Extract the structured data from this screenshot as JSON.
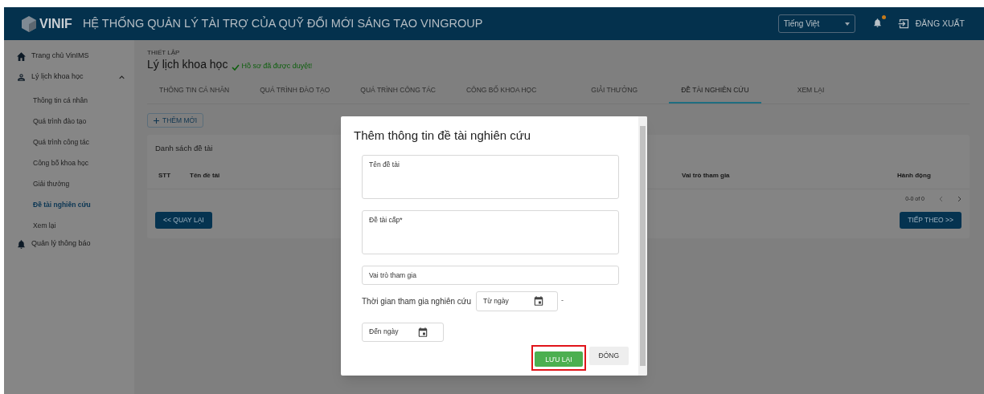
{
  "header": {
    "brand": "VINIF",
    "title": "HỆ THỐNG QUẢN LÝ TÀI TRỢ CỦA QUỸ ĐỔI MỚI SÁNG TẠO VINGROUP",
    "language": "Tiếng Việt",
    "notification_unread": true,
    "logout": "ĐĂNG XUẤT"
  },
  "sidebar": {
    "items": [
      {
        "label": "Trang chủ VinIMS"
      },
      {
        "label": "Lý lịch khoa học",
        "expanded": true,
        "children": [
          {
            "label": "Thông tin cá nhân",
            "selected": false
          },
          {
            "label": "Quá trình đào tạo",
            "selected": false
          },
          {
            "label": "Quá trình công tác",
            "selected": false
          },
          {
            "label": "Công bố khoa học",
            "selected": false
          },
          {
            "label": "Giải thưởng",
            "selected": false
          },
          {
            "label": "Đề tài nghiên cứu",
            "selected": true
          },
          {
            "label": "Xem lại",
            "selected": false
          }
        ]
      },
      {
        "label": "Quản lý thông báo"
      }
    ]
  },
  "page": {
    "breadcrumb": "THIẾT LẬP",
    "title": "Lý lịch khoa học",
    "status": "Hồ sơ đã được duyệt!"
  },
  "tabs": [
    {
      "label": "THÔNG TIN CÁ NHÂN",
      "selected": false
    },
    {
      "label": "QUÁ TRÌNH ĐÀO TẠO",
      "selected": false
    },
    {
      "label": "QUÁ TRÌNH CÔNG TÁC",
      "selected": false
    },
    {
      "label": "CÔNG BỐ KHOA HỌC",
      "selected": false
    },
    {
      "label": "GIẢI THƯỞNG",
      "selected": false
    },
    {
      "label": "ĐỀ TÀI NGHIÊN CỨU",
      "selected": true
    },
    {
      "label": "XEM LẠI",
      "selected": false
    }
  ],
  "add_button": "THÊM MỚI",
  "table": {
    "title": "Danh sách đề tài",
    "columns": [
      "STT",
      "Tên đề tài",
      "Vai trò tham gia",
      "Hành động"
    ],
    "pagination": "0-0 of 0"
  },
  "back_button": "<< QUAY LẠI",
  "next_button": "TIẾP THEO >>",
  "dialog": {
    "title": "Thêm thông tin đề tài nghiên cứu",
    "fields": [
      {
        "kind": "textarea",
        "placeholder": "Tên đề tài"
      },
      {
        "kind": "textarea",
        "placeholder": "Đề tài cấp*"
      },
      {
        "kind": "input",
        "placeholder": "Vai trò tham gia"
      }
    ],
    "period_label": "Thời gian tham gia nghiên cứu",
    "from_date": {
      "placeholder": "Từ ngày"
    },
    "separator": "-",
    "to_date": {
      "placeholder": "Đến ngày"
    },
    "save": {
      "label": "LƯU LẠI",
      "highlighted": true
    },
    "close": "ĐÓNG"
  }
}
